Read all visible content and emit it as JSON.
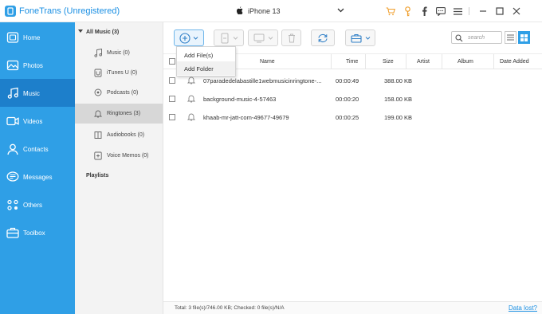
{
  "app": {
    "title": "FoneTrans (Unregistered)",
    "device": "iPhone 13"
  },
  "nav": {
    "items": [
      {
        "label": "Home",
        "icon": "home-icon"
      },
      {
        "label": "Photos",
        "icon": "photos-icon"
      },
      {
        "label": "Music",
        "icon": "music-icon",
        "active": true
      },
      {
        "label": "Videos",
        "icon": "videos-icon"
      },
      {
        "label": "Contacts",
        "icon": "contacts-icon"
      },
      {
        "label": "Messages",
        "icon": "messages-icon"
      },
      {
        "label": "Others",
        "icon": "others-icon"
      },
      {
        "label": "Toolbox",
        "icon": "toolbox-icon"
      }
    ]
  },
  "categories": {
    "header": "All Music (3)",
    "items": [
      {
        "label": "Music (0)",
        "icon": "music-note-icon"
      },
      {
        "label": "iTunes U (0)",
        "icon": "itunes-u-icon"
      },
      {
        "label": "Podcasts (0)",
        "icon": "podcast-icon"
      },
      {
        "label": "Ringtones (3)",
        "icon": "bell-icon",
        "active": true
      },
      {
        "label": "Audiobooks (0)",
        "icon": "audiobook-icon"
      },
      {
        "label": "Voice Memos (0)",
        "icon": "voice-memo-icon"
      }
    ],
    "playlists": "Playlists"
  },
  "search": {
    "placeholder": "search"
  },
  "add_menu": {
    "items": [
      "Add File(s)",
      "Add Folder"
    ]
  },
  "table": {
    "headers": {
      "name": "Name",
      "time": "Time",
      "size": "Size",
      "artist": "Artist",
      "album": "Album",
      "date_added": "Date Added"
    },
    "rows": [
      {
        "name": "07paradedelabastille1webmusicinringtone-...",
        "time": "00:00:49",
        "size": "388.00 KB"
      },
      {
        "name": "background-music-4-57463",
        "time": "00:00:20",
        "size": "158.00 KB"
      },
      {
        "name": "khaab-mr-jatt-com-49677-49679",
        "time": "00:00:25",
        "size": "199.00 KB"
      }
    ]
  },
  "status": {
    "summary": "Total: 3 file(s)/746.00 KB; Checked: 0 file(s)/N/A",
    "link": "Data lost?"
  },
  "colors": {
    "nav_bg": "#2f9fe6",
    "nav_active": "#1d7fcb",
    "accent": "#1a8fe3",
    "icon_orange": "#f0a030"
  }
}
